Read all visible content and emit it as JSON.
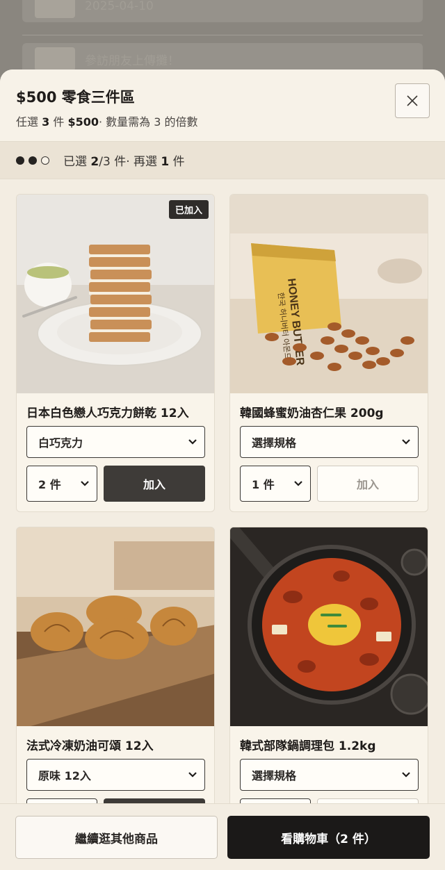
{
  "background": {
    "row1_text": "2025-04-10",
    "row2_text": "參訪朋友上傳攤！"
  },
  "sheet": {
    "title": "$500 零食三件區",
    "subtitle_prefix": "任選",
    "subtitle_count": "3",
    "subtitle_mid": "件",
    "subtitle_price": "$500",
    "subtitle_suffix": "· 數量需為 3 的倍數",
    "close_icon": "close-icon"
  },
  "progress": {
    "filled": 2,
    "total": 3,
    "text_prefix": "已選",
    "selected": "2",
    "text_total": "/3 件· 再選",
    "remaining": "1",
    "text_unit": "件"
  },
  "products": [
    {
      "name": "日本白色戀人巧克力餅乾 12入",
      "variant": "白巧克力",
      "quantity": "2 件",
      "add_label": "加入",
      "added_badge": "已加入",
      "added": true
    },
    {
      "name": "韓國蜂蜜奶油杏仁果 200g",
      "variant": "選擇規格",
      "quantity": "1 件",
      "add_label": "加入",
      "added": false,
      "package_text_1": "HONEY BUTTER",
      "package_text_2": "한국 허니버터 아몬드"
    },
    {
      "name": "法式冷凍奶油可頌 12入",
      "variant": "原味 12入",
      "added": false
    },
    {
      "name": "韓式部隊鍋調理包 1.2kg",
      "variant": "選擇規格",
      "added": false
    }
  ],
  "footer": {
    "continue_label": "繼續逛其他商品",
    "cart_label": "看購物車（2 件）"
  },
  "colors": {
    "sheet_bg": "#f3ede2",
    "primary_dark": "#1b1918",
    "button_dark": "#3e3b38"
  }
}
